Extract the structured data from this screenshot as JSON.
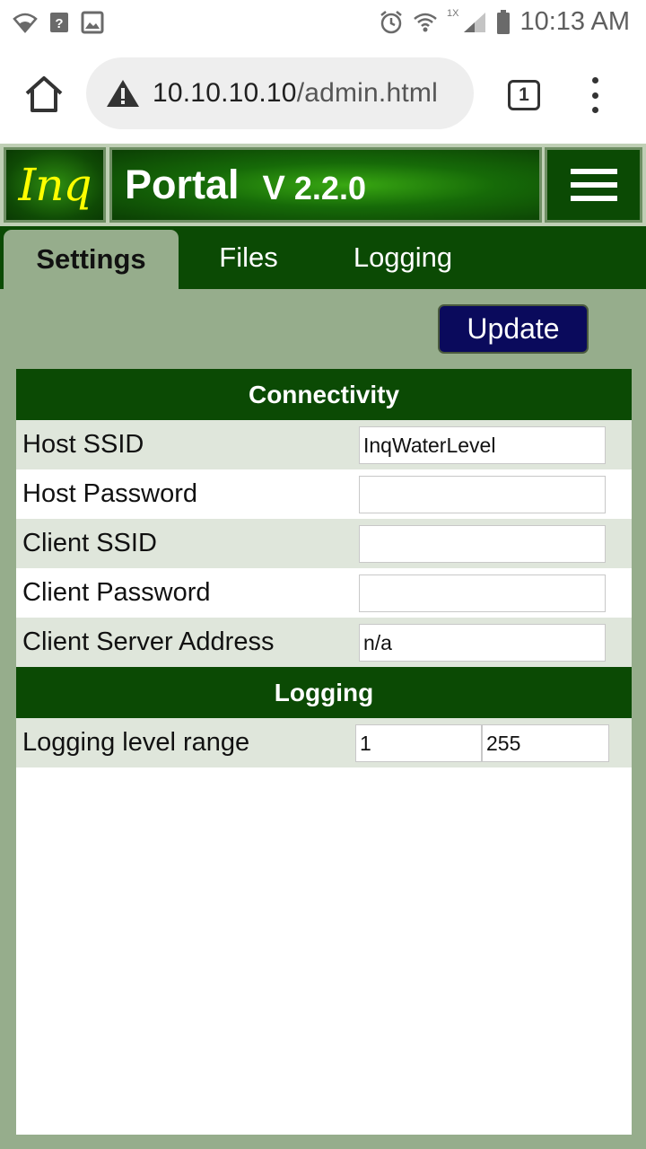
{
  "status_bar": {
    "time": "10:13 AM",
    "network_label": "1X"
  },
  "browser": {
    "url_host": "10.10.10.10",
    "url_path": "/admin.html",
    "tab_count": "1"
  },
  "app": {
    "logo": "Inq",
    "title": "Portal",
    "version_prefix": "V",
    "version": "2.2.0"
  },
  "tabs": [
    {
      "label": "Settings",
      "active": true
    },
    {
      "label": "Files",
      "active": false
    },
    {
      "label": "Logging",
      "active": false
    }
  ],
  "update_label": "Update",
  "sections": {
    "connectivity": {
      "title": "Connectivity",
      "rows": [
        {
          "label": "Host SSID",
          "value": "InqWaterLevel"
        },
        {
          "label": "Host Password",
          "value": ""
        },
        {
          "label": "Client SSID",
          "value": ""
        },
        {
          "label": "Client Password",
          "value": ""
        },
        {
          "label": "Client Server Address",
          "value": "n/a"
        }
      ]
    },
    "logging": {
      "title": "Logging",
      "range_label": "Logging level range",
      "range_min": "1",
      "range_max": "255"
    }
  },
  "colors": {
    "dark_green": "#0b4a04",
    "sage_background": "#96ad8c",
    "row_alt": "#dfe6db",
    "update_button": "#0a0a5c",
    "logo_yellow": "#ffff00"
  }
}
